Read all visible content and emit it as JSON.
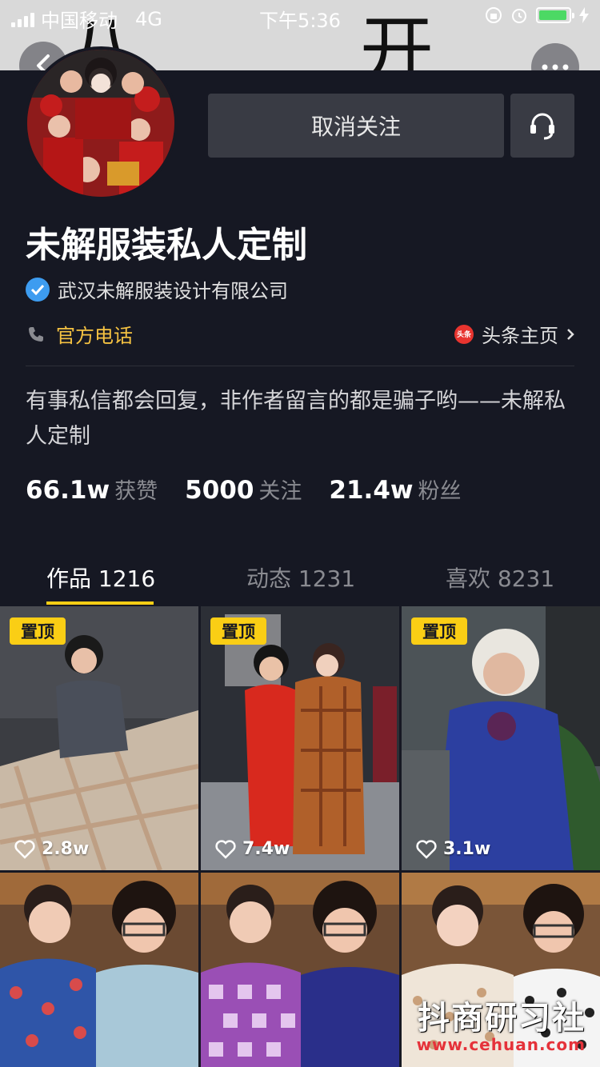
{
  "status_bar": {
    "carrier": "中国移动",
    "network": "4G",
    "time": "下午5:36"
  },
  "cover": {
    "glyphs": [
      "八",
      "开"
    ]
  },
  "header": {
    "unfollow_label": "取消关注"
  },
  "profile": {
    "name": "未解服装私人定制",
    "verified_company": "武汉未解服装设计有限公司",
    "phone_label": "官方电话",
    "toutiao_logo_text": "头条",
    "toutiao_label": "头条主页",
    "bio": "有事私信都会回复，非作者留言的都是骗子哟——未解私人定制",
    "stats": [
      {
        "value": "66.1w",
        "label": "获赞"
      },
      {
        "value": "5000",
        "label": "关注"
      },
      {
        "value": "21.4w",
        "label": "粉丝"
      }
    ]
  },
  "tabs": [
    {
      "label": "作品 1216",
      "active": true
    },
    {
      "label": "动态 1231",
      "active": false
    },
    {
      "label": "喜欢 8231",
      "active": false
    }
  ],
  "videos": [
    {
      "pinned": true,
      "pin_label": "置顶",
      "likes": "2.8w"
    },
    {
      "pinned": true,
      "pin_label": "置顶",
      "likes": "7.4w"
    },
    {
      "pinned": true,
      "pin_label": "置顶",
      "likes": "3.1w"
    },
    {
      "pinned": false
    },
    {
      "pinned": false
    },
    {
      "pinned": false
    }
  ],
  "watermark": {
    "main": "抖商研习社",
    "sub": "www.cehuan.com"
  },
  "colors": {
    "background": "#161823",
    "accent": "#face15",
    "button": "#393b44",
    "verified": "#3d9cf0",
    "phone_text": "#f5c242"
  }
}
